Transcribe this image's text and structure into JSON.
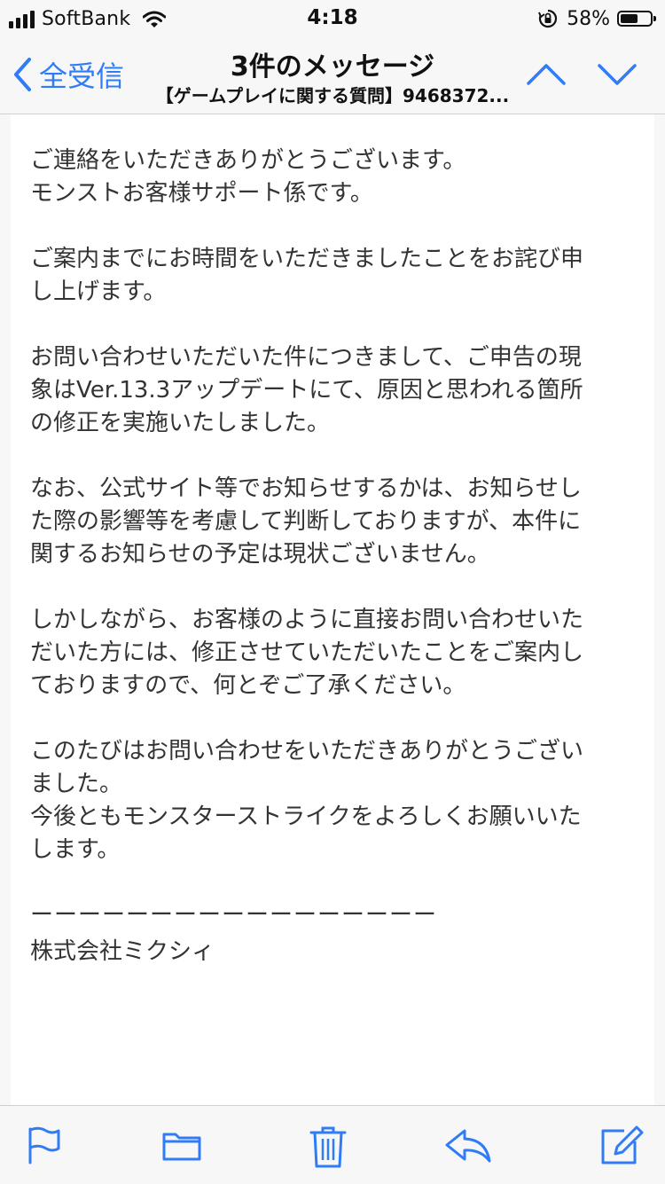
{
  "status_bar": {
    "carrier": "SoftBank",
    "time": "4:18",
    "battery_percent": "58%",
    "battery_level": 0.58,
    "icons": [
      "signal-icon",
      "wifi-icon",
      "orientation-lock-icon",
      "battery-icon"
    ]
  },
  "nav": {
    "back_label": "全受信",
    "title": "3件のメッセージ",
    "subtitle": "【ゲームプレイに関する質問】9468372...",
    "icons": [
      "chevron-left-icon",
      "chevron-up-icon",
      "chevron-down-icon"
    ]
  },
  "message": {
    "paragraphs": [
      "ご連絡をいただきありがとうございます。\nモンストお客様サポート係です。",
      "ご案内までにお時間をいただきましたことをお詫び申\nし上げます。",
      "お問い合わせいただいた件につきまして、ご申告の現\n象はVer.13.3アップデートにて、原因と思われる箇所\nの修正を実施いたしました。",
      "なお、公式サイト等でお知らせするかは、お知らせし\nた際の影響等を考慮して判断しておりますが、本件に\n関するお知らせの予定は現状ございません。",
      "しかしながら、お客様のように直接お問い合わせいた\nだいた方には、修正させていただいたことをご案内し\nておりますので、何とぞご了承ください。",
      "このたびはお問い合わせをいただきありがとうござい\nました。\n今後ともモンスターストライクをよろしくお願いいた\nします。"
    ],
    "signature_line": "ーーーーーーーーーーーーーーーーー",
    "company": "株式会社ミクシィ"
  },
  "toolbar": {
    "icons": [
      "flag-icon",
      "folder-icon",
      "trash-icon",
      "reply-icon",
      "compose-icon"
    ]
  },
  "colors": {
    "accent": "#2f7cf6",
    "bar_background": "#f7f7f7",
    "content_background": "#ffffff",
    "body_text": "#333333"
  }
}
